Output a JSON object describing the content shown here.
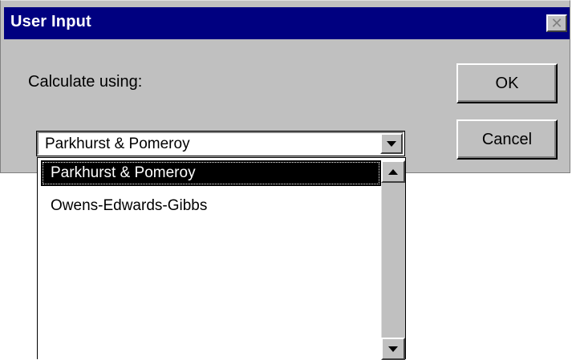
{
  "window": {
    "title": "User Input",
    "close_glyph": "✕"
  },
  "form": {
    "prompt_label": "Calculate using:"
  },
  "buttons": {
    "ok_label": "OK",
    "cancel_label": "Cancel"
  },
  "combo": {
    "selected_value": "Parkhurst & Pomeroy",
    "options": [
      {
        "label": "Parkhurst & Pomeroy",
        "highlighted": true
      },
      {
        "label": "Owens-Edwards-Gibbs",
        "highlighted": false
      }
    ]
  },
  "icons": {
    "close": "close-icon",
    "combo_arrow": "chevron-down-icon",
    "scroll_up": "scroll-up-arrow-icon",
    "scroll_down": "scroll-down-arrow-icon"
  },
  "colors": {
    "titlebar": "#000080",
    "dialog_face": "#c0c0c0",
    "highlight": "#000000"
  }
}
